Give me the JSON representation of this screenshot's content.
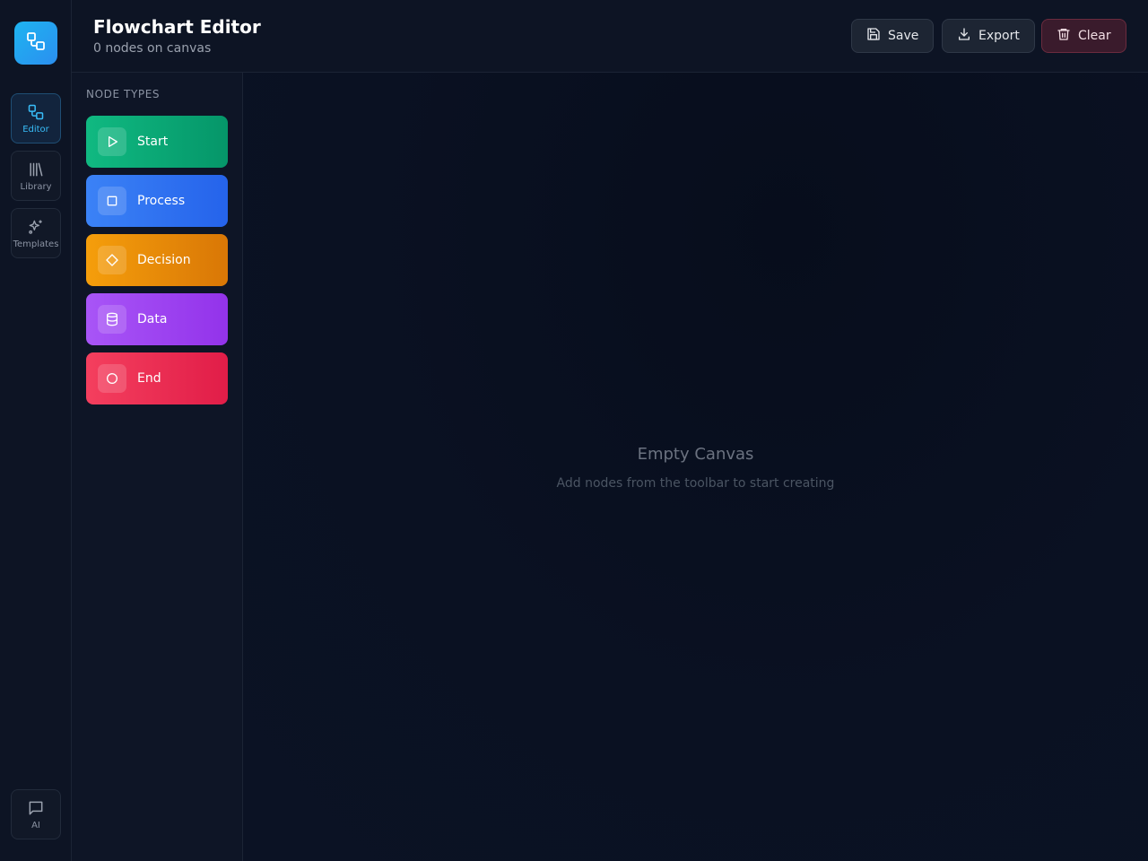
{
  "app": {
    "title": "Flowchart Editor",
    "node_count_text": "0 nodes on canvas"
  },
  "rail": {
    "logo_icon": "flowchart-icon",
    "items": [
      {
        "label": "Editor",
        "icon": "flowchart-icon",
        "active": true
      },
      {
        "label": "Library",
        "icon": "library-icon",
        "active": false
      },
      {
        "label": "Templates",
        "icon": "sparkles-icon",
        "active": false
      }
    ],
    "bottom": {
      "label": "AI",
      "icon": "chat-icon"
    }
  },
  "toolbar": {
    "save_label": "Save",
    "export_label": "Export",
    "clear_label": "Clear"
  },
  "panel": {
    "title": "NODE TYPES",
    "nodes": [
      {
        "label": "Start",
        "icon": "play-icon",
        "color_from": "#10b981",
        "color_to": "#059669"
      },
      {
        "label": "Process",
        "icon": "square-icon",
        "color_from": "#3b82f6",
        "color_to": "#2563eb"
      },
      {
        "label": "Decision",
        "icon": "diamond-icon",
        "color_from": "#f59e0b",
        "color_to": "#d97706"
      },
      {
        "label": "Data",
        "icon": "database-icon",
        "color_from": "#a855f7",
        "color_to": "#9333ea"
      },
      {
        "label": "End",
        "icon": "circle-icon",
        "color_from": "#f43f5e",
        "color_to": "#e11d48"
      }
    ]
  },
  "canvas": {
    "empty_title": "Empty Canvas",
    "empty_subtitle": "Add nodes from the toolbar to start creating"
  }
}
